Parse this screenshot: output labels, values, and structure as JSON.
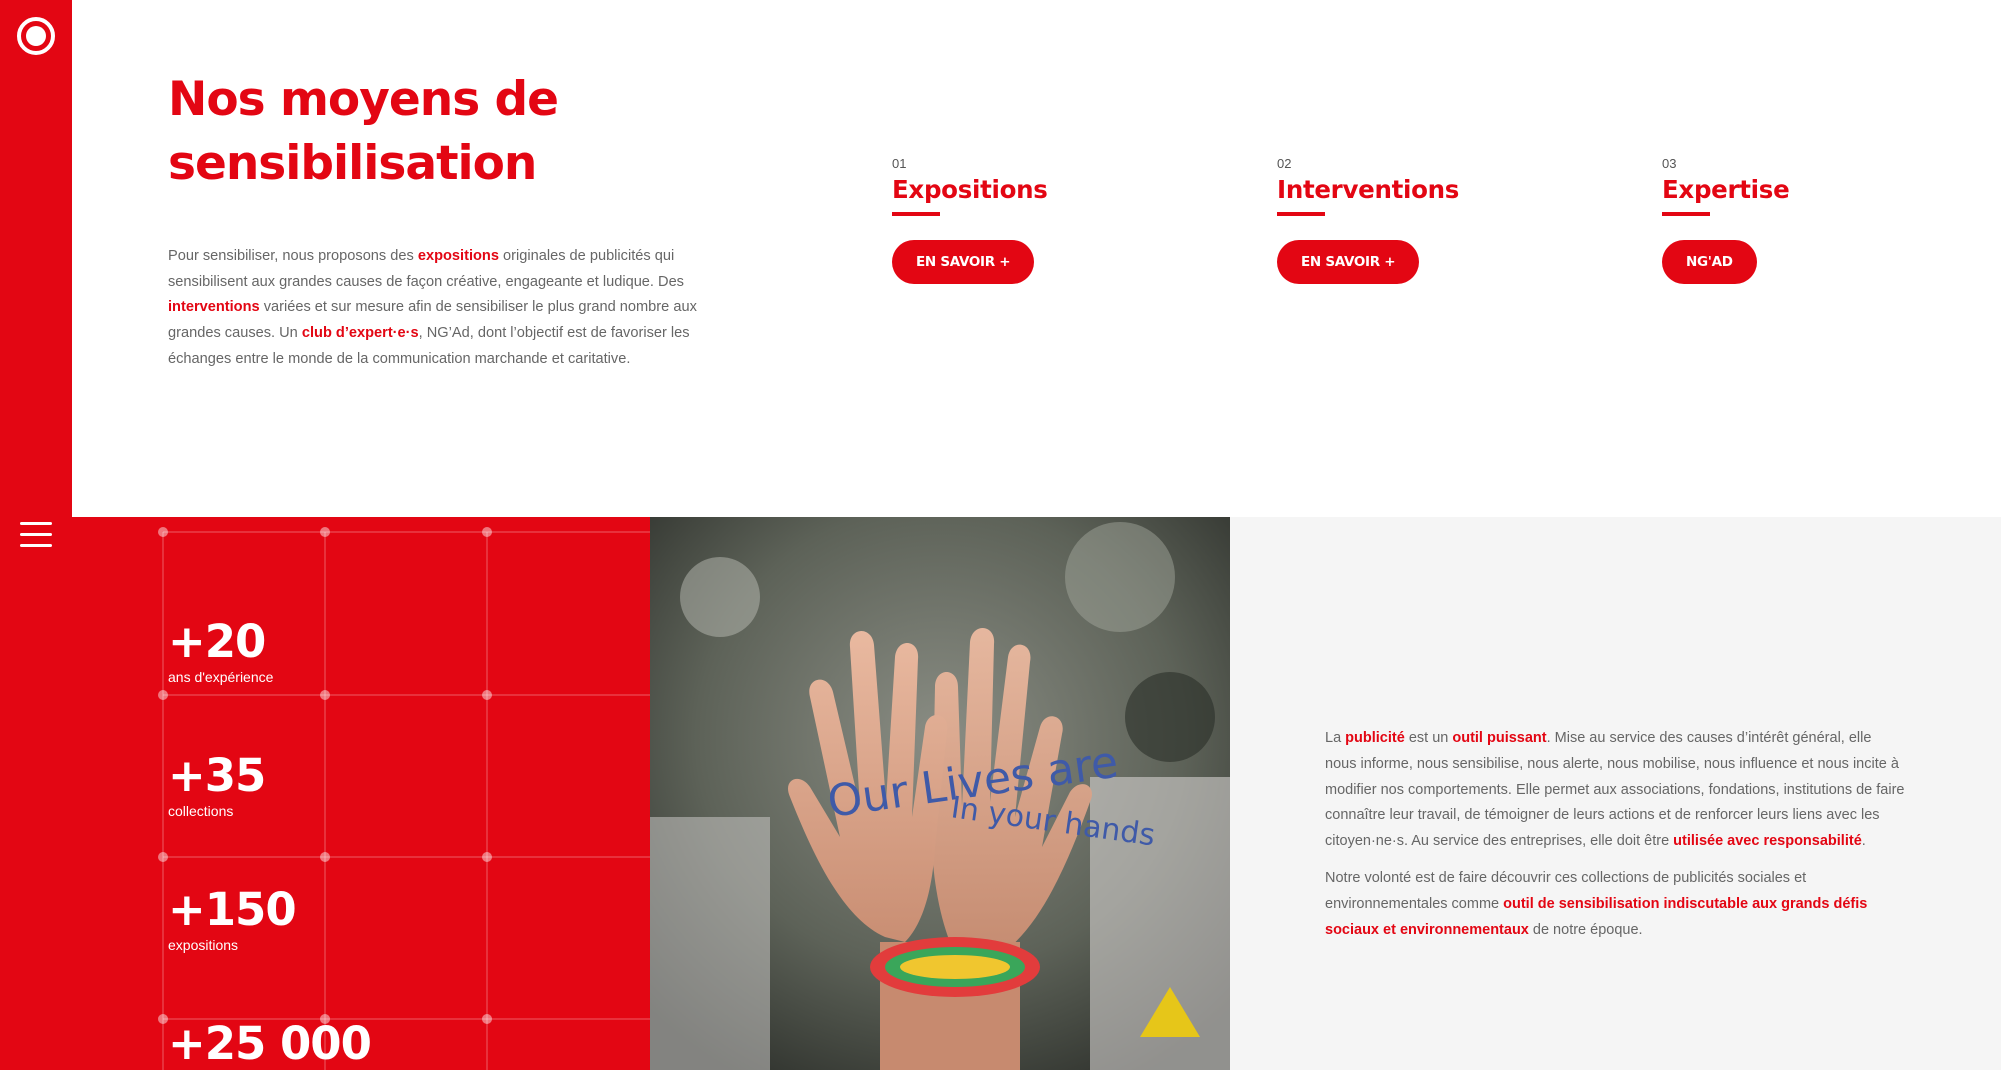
{
  "hero": {
    "title_line1": "Nos moyens de",
    "title_line2": "sensibilisation"
  },
  "intro": {
    "t1": "Pour sensibiliser, nous proposons des ",
    "b1": "expositions",
    "t2": " originales de publicités qui sensibilisent aux grandes causes de façon créative, engageante et ludique. Des ",
    "b2": "interventions",
    "t3": " variées et sur mesure afin de sensibiliser le plus grand nombre aux grandes causes. Un ",
    "b3": "club d’expert·e·s",
    "t4": ", NG’Ad, dont l’objectif est de favoriser les échanges entre le monde de la communication marchande et caritative."
  },
  "columns": [
    {
      "num": "01",
      "title": "Expositions",
      "button": "EN SAVOIR +"
    },
    {
      "num": "02",
      "title": "Interventions",
      "button": "EN SAVOIR +"
    },
    {
      "num": "03",
      "title": "Expertise",
      "button": "NG'AD"
    }
  ],
  "stats": [
    {
      "value": "+20",
      "label": "ans d'expérience"
    },
    {
      "value": "+35",
      "label": "collections"
    },
    {
      "value": "+150",
      "label": "expositions"
    },
    {
      "value": "+25 000",
      "label": ""
    }
  ],
  "description": {
    "p1_a": "La ",
    "p1_b1": "publicité",
    "p1_c": " est un ",
    "p1_b2": "outil puissant",
    "p1_d": ". Mise au service des causes d’intérêt général, elle nous informe, nous sensibilise, nous alerte, nous mobilise, nous influence et nous incite à modifier nos comportements. Elle permet aux associations, fondations, institutions de faire connaître leur travail, de témoigner de leurs actions et de renforcer leurs liens avec les citoyen·ne·s. Au service des entreprises, elle doit être ",
    "p1_b3": "utilisée avec responsabilité",
    "p1_e": ".",
    "p2_a": "Notre volonté est de faire découvrir ces collections de publicités sociales et environnementales comme ",
    "p2_b": "outil de sensibilisation indiscutable aux grands défis sociaux et environnementaux",
    "p2_c": " de notre époque."
  },
  "photo": {
    "hand_left_text": "Our Lives are",
    "hand_right_text": "In your hands"
  },
  "colors": {
    "accent": "#e30613",
    "panel": "#f5f5f5",
    "text": "#666666"
  },
  "icons": {
    "logo": "circle-logo-icon",
    "menu": "hamburger-menu-icon"
  }
}
